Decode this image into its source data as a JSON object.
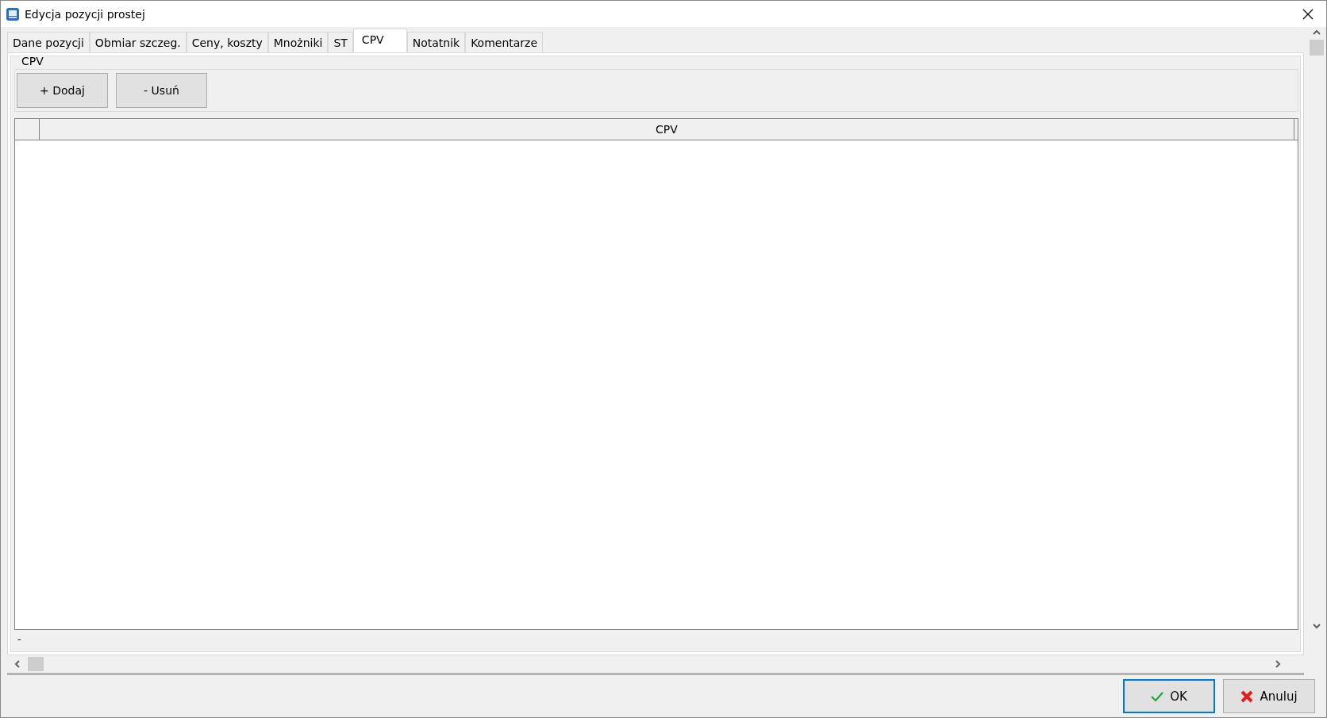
{
  "window": {
    "title": "Edycja pozycji prostej"
  },
  "tabs": [
    {
      "label": "Dane pozycji",
      "selected": false
    },
    {
      "label": "Obmiar szczeg.",
      "selected": false
    },
    {
      "label": "Ceny, koszty",
      "selected": false
    },
    {
      "label": "Mnożniki",
      "selected": false
    },
    {
      "label": "ST",
      "selected": false
    },
    {
      "label": "CPV",
      "selected": true
    },
    {
      "label": "Notatnik",
      "selected": false
    },
    {
      "label": "Komentarze",
      "selected": false
    }
  ],
  "group": {
    "title": "CPV",
    "buttons": [
      "+ Dodaj",
      "- Usuń"
    ]
  },
  "table": {
    "columns": [
      "CPV"
    ]
  },
  "status_text": "-",
  "footer_buttons": [
    {
      "label": "OK",
      "kind": "ok",
      "selected": true
    },
    {
      "label": "Anuluj",
      "kind": "cancel",
      "selected": false
    }
  ]
}
